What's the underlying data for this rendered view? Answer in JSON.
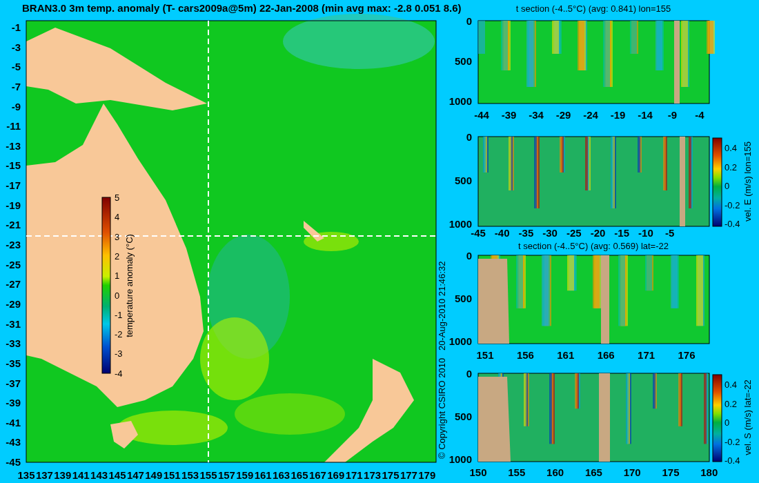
{
  "title": "BRAN3.0 3m temp. anomaly (T- cars2009a@5m) 22-Jan-2008 (min avg max: -2.8 0.051 8.6)",
  "map": {
    "yticks": [
      "-1",
      "-3",
      "-5",
      "-7",
      "-9",
      "-11",
      "-13",
      "-15",
      "-17",
      "-19",
      "-21",
      "-23",
      "-25",
      "-27",
      "-29",
      "-31",
      "-33",
      "-35",
      "-37",
      "-39",
      "-41",
      "-43",
      "-45"
    ],
    "xticks": [
      "135",
      "137",
      "139",
      "141",
      "143",
      "145",
      "147",
      "149",
      "151",
      "153",
      "155",
      "157",
      "159",
      "161",
      "163",
      "165",
      "167",
      "169",
      "171",
      "173",
      "175",
      "177",
      "179"
    ],
    "colorbar": {
      "ticks": [
        "5",
        "4",
        "3",
        "2",
        "1",
        "0",
        "-1",
        "-2",
        "-3",
        "-4"
      ],
      "label": "temperature anomaly (°C)"
    }
  },
  "copyright": "© Copyright CSIRO 2010",
  "timestamp": "20-Aug-2010 21:46:32",
  "sections": [
    {
      "title": "t section (-4..5°C) (avg: 0.841) lon=155",
      "yticks": [
        "0",
        "500",
        "1000"
      ],
      "xticks": [
        "-44",
        "-39",
        "-34",
        "-29",
        "-24",
        "-19",
        "-14",
        "-9",
        "-4"
      ]
    },
    {
      "yticks": [
        "0",
        "500",
        "1000"
      ],
      "xticks": [
        "-45",
        "-40",
        "-35",
        "-30",
        "-25",
        "-20",
        "-15",
        "-10",
        "-5"
      ],
      "colorbar": {
        "ticks": [
          "0.4",
          "0.2",
          "0",
          "-0.2",
          "-0.4"
        ],
        "label": "vel. E (m/s) lon=155"
      }
    },
    {
      "title": "t section (-4..5°C) (avg: 0.569) lat=-22",
      "yticks": [
        "0",
        "500",
        "1000"
      ],
      "xticks": [
        "151",
        "156",
        "161",
        "166",
        "171",
        "176"
      ]
    },
    {
      "yticks": [
        "0",
        "500",
        "1000"
      ],
      "xticks": [
        "150",
        "155",
        "160",
        "165",
        "170",
        "175",
        "180"
      ],
      "colorbar": {
        "ticks": [
          "0.4",
          "0.2",
          "0",
          "-0.2",
          "-0.4"
        ],
        "label": "vel. S (m/s) lat=-22"
      }
    }
  ]
}
